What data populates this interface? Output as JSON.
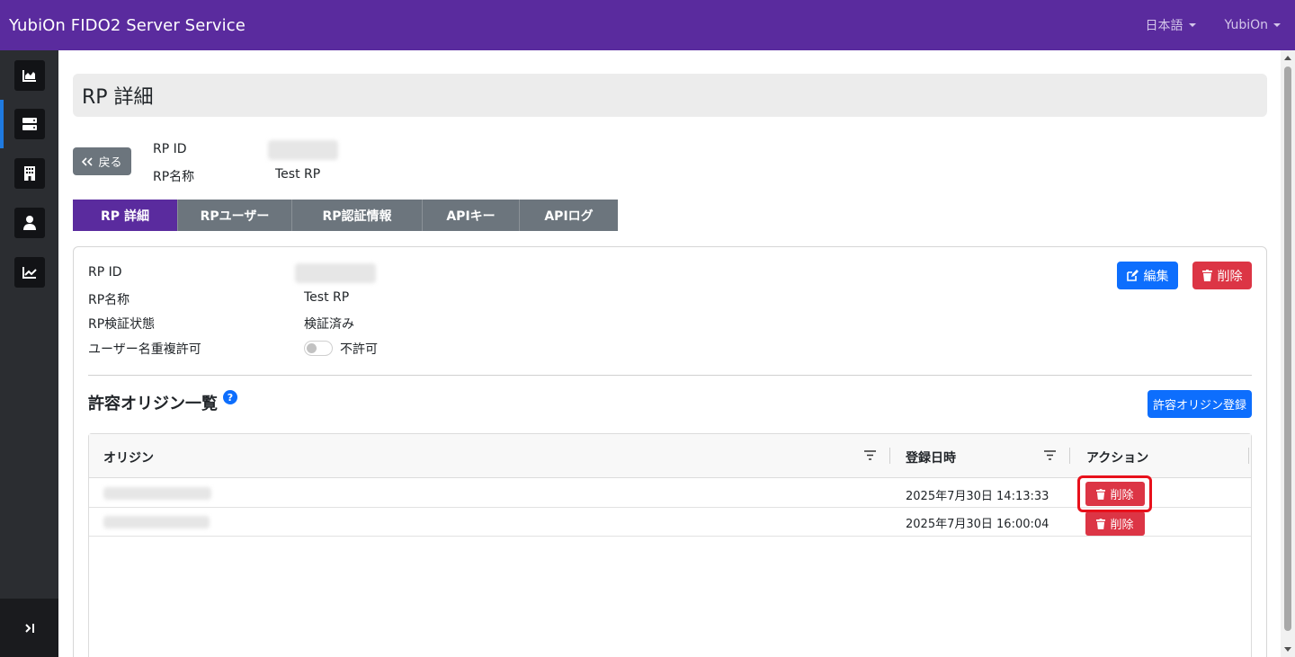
{
  "app": {
    "title": "YubiOn FIDO2 Server Service"
  },
  "nav": {
    "language": "日本語",
    "user": "YubiOn"
  },
  "sidebar": {
    "items": [
      {
        "icon": "area-chart-icon"
      },
      {
        "icon": "server-icon"
      },
      {
        "icon": "building-icon"
      },
      {
        "icon": "user-icon"
      },
      {
        "icon": "line-chart-icon"
      }
    ],
    "toggle_icon": "collapse-expand-icon"
  },
  "page": {
    "title": "RP 詳細",
    "back_label": "戻る",
    "summary": {
      "rp_id_label": "RP ID",
      "rp_name_label": "RP名称",
      "rp_name_value": "Test RP"
    }
  },
  "tabs": [
    {
      "label": "RP 詳細",
      "active": true
    },
    {
      "label": "RPユーザー",
      "active": false
    },
    {
      "label": "RP認証情報",
      "active": false
    },
    {
      "label": "APIキー",
      "active": false
    },
    {
      "label": "APIログ",
      "active": false
    }
  ],
  "detail": {
    "rp_id_label": "RP ID",
    "rp_name_label": "RP名称",
    "rp_name_value": "Test RP",
    "verify_label": "RP検証状態",
    "verify_value": "検証済み",
    "dup_label": "ユーザー名重複許可",
    "dup_value": "不許可",
    "dup_enabled": false,
    "edit_label": "編集",
    "delete_label": "削除"
  },
  "origins": {
    "title": "許容オリジン一覧",
    "help_glyph": "?",
    "register_label": "許容オリジン登録",
    "columns": {
      "origin": "オリジン",
      "registered": "登録日時",
      "action": "アクション"
    },
    "rows": [
      {
        "registered": "2025年7月30日 14:13:33",
        "delete_label": "削除"
      },
      {
        "registered": "2025年7月30日 16:00:04",
        "delete_label": "削除"
      }
    ]
  },
  "colors": {
    "brand_purple": "#5a2b9e",
    "primary": "#0d6efd",
    "danger": "#dc3545",
    "secondary": "#6c757d",
    "sidebar": "#2b2d31",
    "highlight": "#e8101b"
  }
}
